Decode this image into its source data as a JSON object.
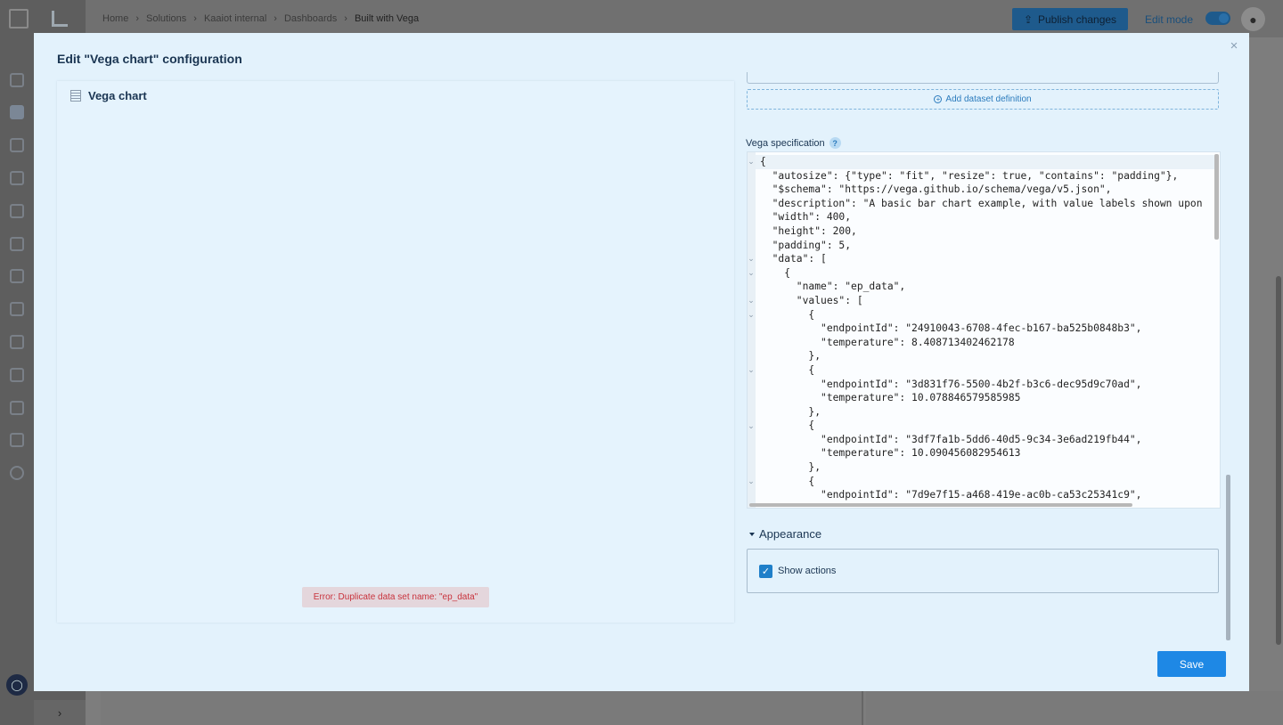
{
  "topbar": {
    "breadcrumbs": [
      "Home",
      "Solutions",
      "Kaaiot internal",
      "Dashboards",
      "Built with Vega"
    ],
    "publish_label": "Publish changes",
    "edit_mode_label": "Edit mode"
  },
  "modal": {
    "title": "Edit \"Vega chart\" configuration",
    "close_glyph": "×",
    "preview": {
      "title": "Vega chart",
      "error": "Error: Duplicate data set name: \"ep_data\""
    },
    "add_dataset_label": "Add dataset definition",
    "spec_label": "Vega specification",
    "help_glyph": "?",
    "code_lines": [
      "{",
      "  \"autosize\": {\"type\": \"fit\", \"resize\": true, \"contains\": \"padding\"},",
      "  \"$schema\": \"https://vega.github.io/schema/vega/v5.json\",",
      "  \"description\": \"A basic bar chart example, with value labels shown upon",
      "  \"width\": 400,",
      "  \"height\": 200,",
      "  \"padding\": 5,",
      "  \"data\": [",
      "    {",
      "      \"name\": \"ep_data\",",
      "      \"values\": [",
      "        {",
      "          \"endpointId\": \"24910043-6708-4fec-b167-ba525b0848b3\",",
      "          \"temperature\": 8.408713402462178",
      "        },",
      "        {",
      "          \"endpointId\": \"3d831f76-5500-4b2f-b3c6-dec95d9c70ad\",",
      "          \"temperature\": 10.078846579585985",
      "        },",
      "        {",
      "          \"endpointId\": \"3df7fa1b-5dd6-40d5-9c34-3e6ad219fb44\",",
      "          \"temperature\": 10.090456082954613",
      "        },",
      "        {",
      "          \"endpointId\": \"7d9e7f15-a468-419e-ac0b-ca53c25341c9\","
    ],
    "appearance_label": "Appearance",
    "show_actions_label": "Show actions",
    "show_actions_checked": true,
    "save_label": "Save"
  }
}
